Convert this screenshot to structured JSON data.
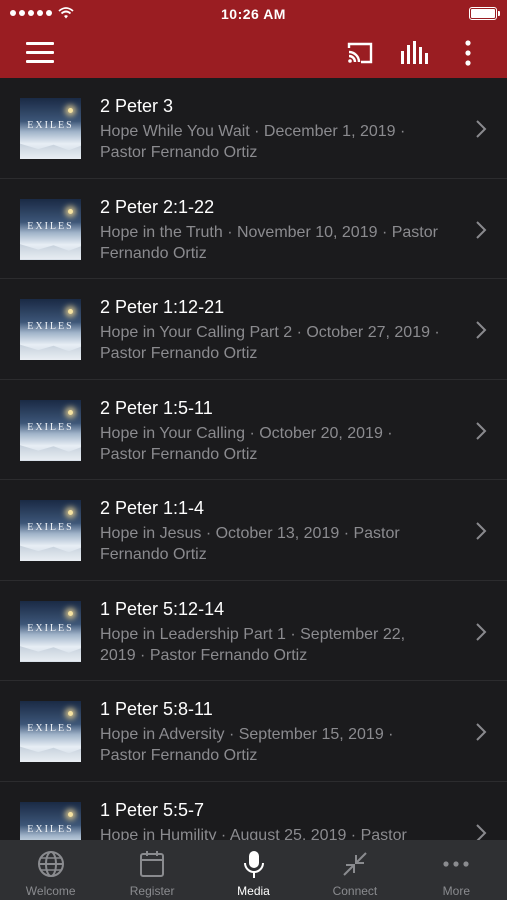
{
  "status_bar": {
    "time": "10:26 AM"
  },
  "sermons": [
    {
      "title": "2 Peter 3",
      "subtitle": "Hope While You Wait · December 1, 2019 · Pastor Fernando Ortiz",
      "thumb_text": "EXILES"
    },
    {
      "title": "2 Peter 2:1-22",
      "subtitle": "Hope in the Truth · November 10, 2019 · Pastor Fernando Ortiz",
      "thumb_text": "EXILES"
    },
    {
      "title": "2 Peter 1:12-21",
      "subtitle": "Hope in Your Calling Part 2 · October 27, 2019 · Pastor Fernando Ortiz",
      "thumb_text": "EXILES"
    },
    {
      "title": "2 Peter 1:5-11",
      "subtitle": "Hope in Your Calling · October 20, 2019 · Pastor Fernando Ortiz",
      "thumb_text": "EXILES"
    },
    {
      "title": "2 Peter 1:1-4",
      "subtitle": "Hope in Jesus · October 13, 2019 · Pastor Fernando Ortiz",
      "thumb_text": "EXILES"
    },
    {
      "title": "1 Peter 5:12-14",
      "subtitle": "Hope in Leadership Part 1 · September 22, 2019 · Pastor Fernando Ortiz",
      "thumb_text": "EXILES"
    },
    {
      "title": "1 Peter 5:8-11",
      "subtitle": "Hope in Adversity · September 15, 2019 · Pastor Fernando Ortiz",
      "thumb_text": "EXILES"
    },
    {
      "title": "1 Peter 5:5-7",
      "subtitle": "Hope in Humility · August 25, 2019 · Pastor",
      "thumb_text": "EXILES"
    }
  ],
  "tabs": [
    {
      "label": "Welcome",
      "icon": "globe-icon",
      "active": false
    },
    {
      "label": "Register",
      "icon": "calendar-icon",
      "active": false
    },
    {
      "label": "Media",
      "icon": "microphone-icon",
      "active": true
    },
    {
      "label": "Connect",
      "icon": "collapse-arrows-icon",
      "active": false
    },
    {
      "label": "More",
      "icon": "more-horizontal-icon",
      "active": false
    }
  ],
  "colors": {
    "header": "#9a1d22",
    "background": "#1b1b1d",
    "tab_bar": "#2f3033",
    "secondary_text": "#8b8b8f"
  }
}
